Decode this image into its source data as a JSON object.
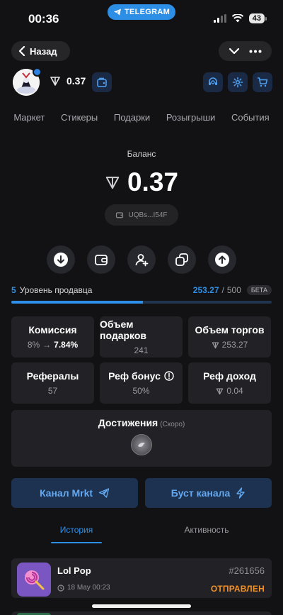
{
  "status_bar": {
    "time": "00:36",
    "battery": "43",
    "telegram_label": "TELEGRAM"
  },
  "nav": {
    "back_label": "Назад"
  },
  "profile": {
    "balance": "0.37"
  },
  "tabs": [
    "Маркет",
    "Стикеры",
    "Подарки",
    "Розыгрыши",
    "События"
  ],
  "balance": {
    "label": "Баланс",
    "value": "0.37",
    "address": "UQBs...I54F"
  },
  "seller_level": {
    "level": "5",
    "label": "Уровень продавца",
    "current": "253.27",
    "separator": "/",
    "max": "500",
    "badge": "БЕТА",
    "progress_fraction": 0.5065
  },
  "stats": [
    {
      "title": "Комиссия",
      "old": "8%",
      "arrow": "→",
      "value": "7.84%"
    },
    {
      "title": "Объем подарков",
      "value": "241"
    },
    {
      "title": "Объем торгов",
      "value": "253.27"
    },
    {
      "title": "Рефералы",
      "value": "57"
    },
    {
      "title": "Реф бонус",
      "value": "50%"
    },
    {
      "title": "Реф доход",
      "value": "0.04"
    }
  ],
  "achievements": {
    "title": "Достижения",
    "note": "(Скоро)"
  },
  "buttons": {
    "channel": "Канал Mrkt",
    "boost": "Буст канала"
  },
  "bottom_tabs": {
    "history": "История",
    "activity": "Активность"
  },
  "history": [
    {
      "name": "Lol Pop",
      "date": "18 May 00:23",
      "number": "#261656",
      "status": "ОТПРАВЛЕН"
    }
  ],
  "colors": {
    "accent": "#2d8fe7",
    "status_sent": "#f0902a",
    "background": "#121214",
    "card": "#222226"
  }
}
